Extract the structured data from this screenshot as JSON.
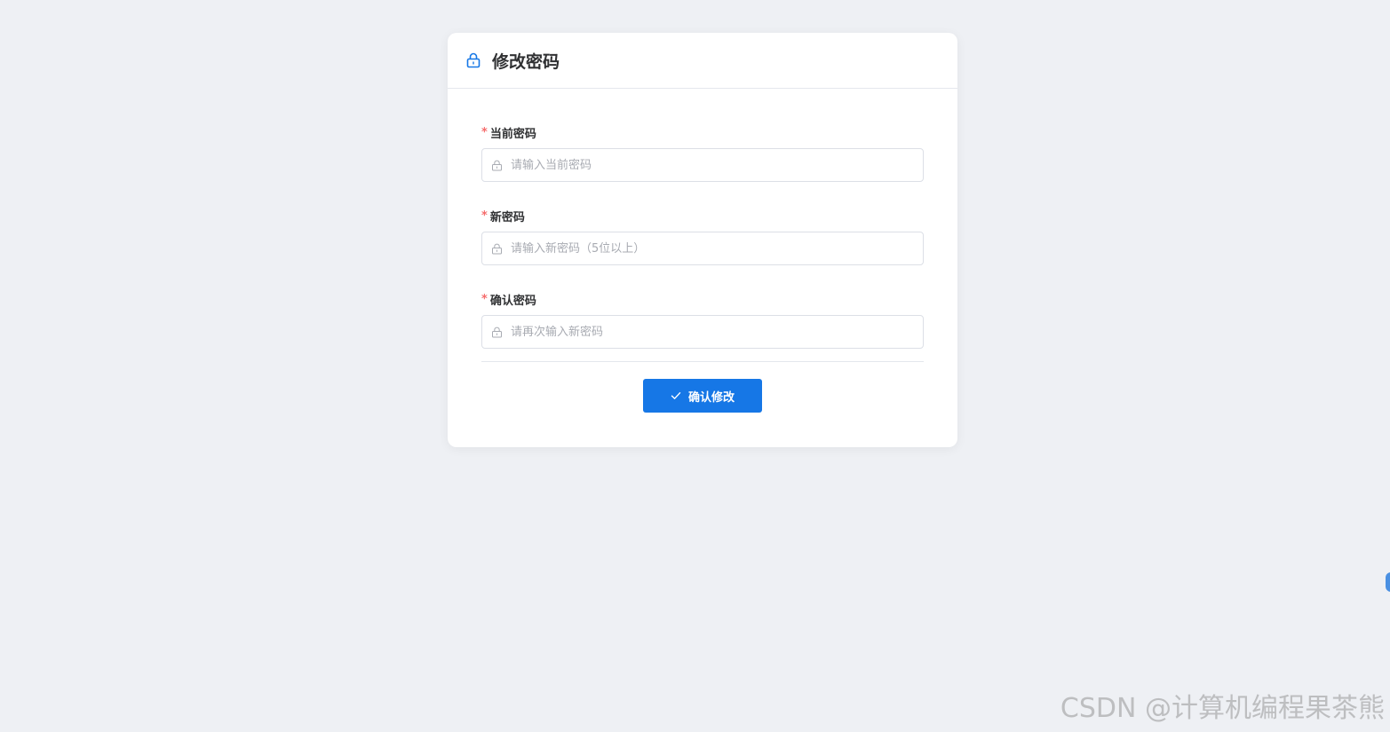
{
  "card": {
    "title": "修改密码",
    "icon": "lock-icon"
  },
  "form": {
    "fields": [
      {
        "label": "当前密码",
        "required": "*",
        "placeholder": "请输入当前密码",
        "value": ""
      },
      {
        "label": "新密码",
        "required": "*",
        "placeholder": "请输入新密码（5位以上）",
        "value": ""
      },
      {
        "label": "确认密码",
        "required": "*",
        "placeholder": "请再次输入新密码",
        "value": ""
      }
    ],
    "submit_label": "确认修改"
  },
  "watermark": "CSDN @计算机编程果茶熊",
  "colors": {
    "primary": "#1677e6",
    "required": "#f56c6c",
    "background": "#eef0f4"
  }
}
